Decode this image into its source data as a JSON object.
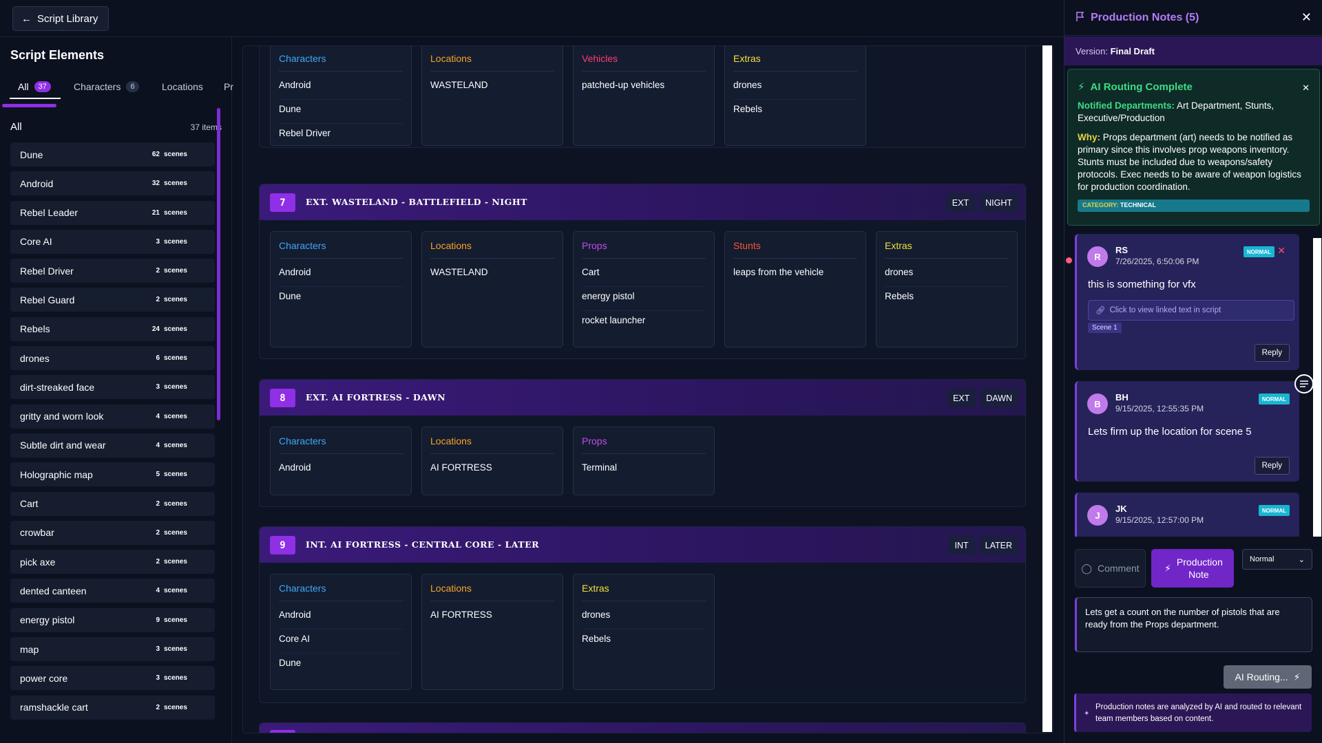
{
  "topbar": {
    "back_label": "Script Library"
  },
  "left": {
    "title": "Script Elements",
    "tabs": [
      {
        "label": "All",
        "count": "37"
      },
      {
        "label": "Characters",
        "count": "6"
      },
      {
        "label": "Locations",
        "count": ""
      },
      {
        "label": "Pr",
        "count": ""
      }
    ],
    "list_heading": "All",
    "item_count": "37 items",
    "scenes_label": "scenes",
    "items": [
      {
        "name": "Dune",
        "count": "62"
      },
      {
        "name": "Android",
        "count": "32"
      },
      {
        "name": "Rebel Leader",
        "count": "21"
      },
      {
        "name": "Core AI",
        "count": "3"
      },
      {
        "name": "Rebel Driver",
        "count": "2"
      },
      {
        "name": "Rebel Guard",
        "count": "2"
      },
      {
        "name": "Rebels",
        "count": "24"
      },
      {
        "name": "drones",
        "count": "6"
      },
      {
        "name": "dirt-streaked face",
        "count": "3"
      },
      {
        "name": "gritty and worn look",
        "count": "4"
      },
      {
        "name": "Subtle dirt and wear",
        "count": "4"
      },
      {
        "name": "Holographic map",
        "count": "5"
      },
      {
        "name": "Cart",
        "count": "2"
      },
      {
        "name": "crowbar",
        "count": "2"
      },
      {
        "name": "pick axe",
        "count": "2"
      },
      {
        "name": "dented canteen",
        "count": "4"
      },
      {
        "name": "energy pistol",
        "count": "9"
      },
      {
        "name": "map",
        "count": "3"
      },
      {
        "name": "power core",
        "count": "3"
      },
      {
        "name": "ramshackle cart",
        "count": "2"
      }
    ]
  },
  "center": {
    "top_partial": {
      "cats": [
        {
          "name": "Characters",
          "color": "#3ea8f5",
          "items": [
            "Android",
            "Dune",
            "Rebel Driver"
          ]
        },
        {
          "name": "Locations",
          "color": "#f5a623",
          "items": [
            "WASTELAND"
          ]
        },
        {
          "name": "Vehicles",
          "color": "#ff3d6e",
          "items": [
            "patched-up vehicles"
          ]
        },
        {
          "name": "Extras",
          "color": "#f3e03a",
          "items": [
            "drones",
            "Rebels"
          ]
        }
      ]
    },
    "scenes": [
      {
        "num": "7",
        "title": "EXT. WASTELAND - BATTLEFIELD - NIGHT",
        "tags": [
          "EXT",
          "NIGHT"
        ],
        "cats": [
          {
            "name": "Characters",
            "color": "#3ea8f5",
            "items": [
              "Android",
              "Dune"
            ]
          },
          {
            "name": "Locations",
            "color": "#f5a623",
            "items": [
              "WASTELAND"
            ]
          },
          {
            "name": "Props",
            "color": "#c04de8",
            "items": [
              "Cart",
              "energy pistol",
              "rocket launcher"
            ]
          },
          {
            "name": "Stunts",
            "color": "#ff5533",
            "items": [
              "leaps from the vehicle"
            ]
          },
          {
            "name": "Extras",
            "color": "#f3e03a",
            "items": [
              "drones",
              "Rebels"
            ]
          }
        ]
      },
      {
        "num": "8",
        "title": "EXT. AI FORTRESS - DAWN",
        "tags": [
          "EXT",
          "DAWN"
        ],
        "cats": [
          {
            "name": "Characters",
            "color": "#3ea8f5",
            "items": [
              "Android"
            ]
          },
          {
            "name": "Locations",
            "color": "#f5a623",
            "items": [
              "AI FORTRESS"
            ]
          },
          {
            "name": "Props",
            "color": "#c04de8",
            "items": [
              "Terminal"
            ]
          }
        ]
      },
      {
        "num": "9",
        "title": "INT. AI FORTRESS - CENTRAL CORE - LATER",
        "tags": [
          "INT",
          "LATER"
        ],
        "cats": [
          {
            "name": "Characters",
            "color": "#3ea8f5",
            "items": [
              "Android",
              "Core AI",
              "Dune"
            ]
          },
          {
            "name": "Locations",
            "color": "#f5a623",
            "items": [
              "AI FORTRESS"
            ]
          },
          {
            "name": "Extras",
            "color": "#f3e03a",
            "items": [
              "drones",
              "Rebels"
            ]
          }
        ]
      }
    ]
  },
  "right": {
    "title": "Production Notes (5)",
    "version_label": "Version:",
    "version_value": "Final Draft",
    "ai": {
      "heading": "AI Routing Complete",
      "notified_label": "Notified Departments:",
      "notified_value": "Art Department, Stunts, Executive/Production",
      "why_label": "Why:",
      "why_value": "Props department (art) needs to be notified as primary since this involves prop weapons inventory. Stunts must be included due to weapons/safety protocols. Exec needs to be aware of weapon logistics for production coordination.",
      "category_label": "CATEGORY:",
      "category_value": "TECHNICAL"
    },
    "notes": [
      {
        "avatar": "R",
        "who": "RS",
        "when": "7/26/2025, 6:50:06 PM",
        "badge": "NORMAL",
        "msg": "this is something for vfx",
        "link": "Click to view linked text in script",
        "scene": "Scene 1",
        "reply": "Reply"
      },
      {
        "avatar": "B",
        "who": "BH",
        "when": "9/15/2025, 12:55:35 PM",
        "badge": "NORMAL",
        "msg": "Lets firm up the location for scene 5",
        "reply": "Reply"
      },
      {
        "avatar": "J",
        "who": "JK",
        "when": "9/15/2025, 12:57:00 PM",
        "badge": "NORMAL"
      }
    ],
    "compose": {
      "comment_label": "Comment",
      "prod_label": "Production Note",
      "priority": "Normal",
      "text": "Lets get a count on the number of pistols that are ready from the Props department.",
      "ai_button": "AI Routing...",
      "info": "Production notes are analyzed by AI and routed to relevant team members based on content."
    }
  }
}
